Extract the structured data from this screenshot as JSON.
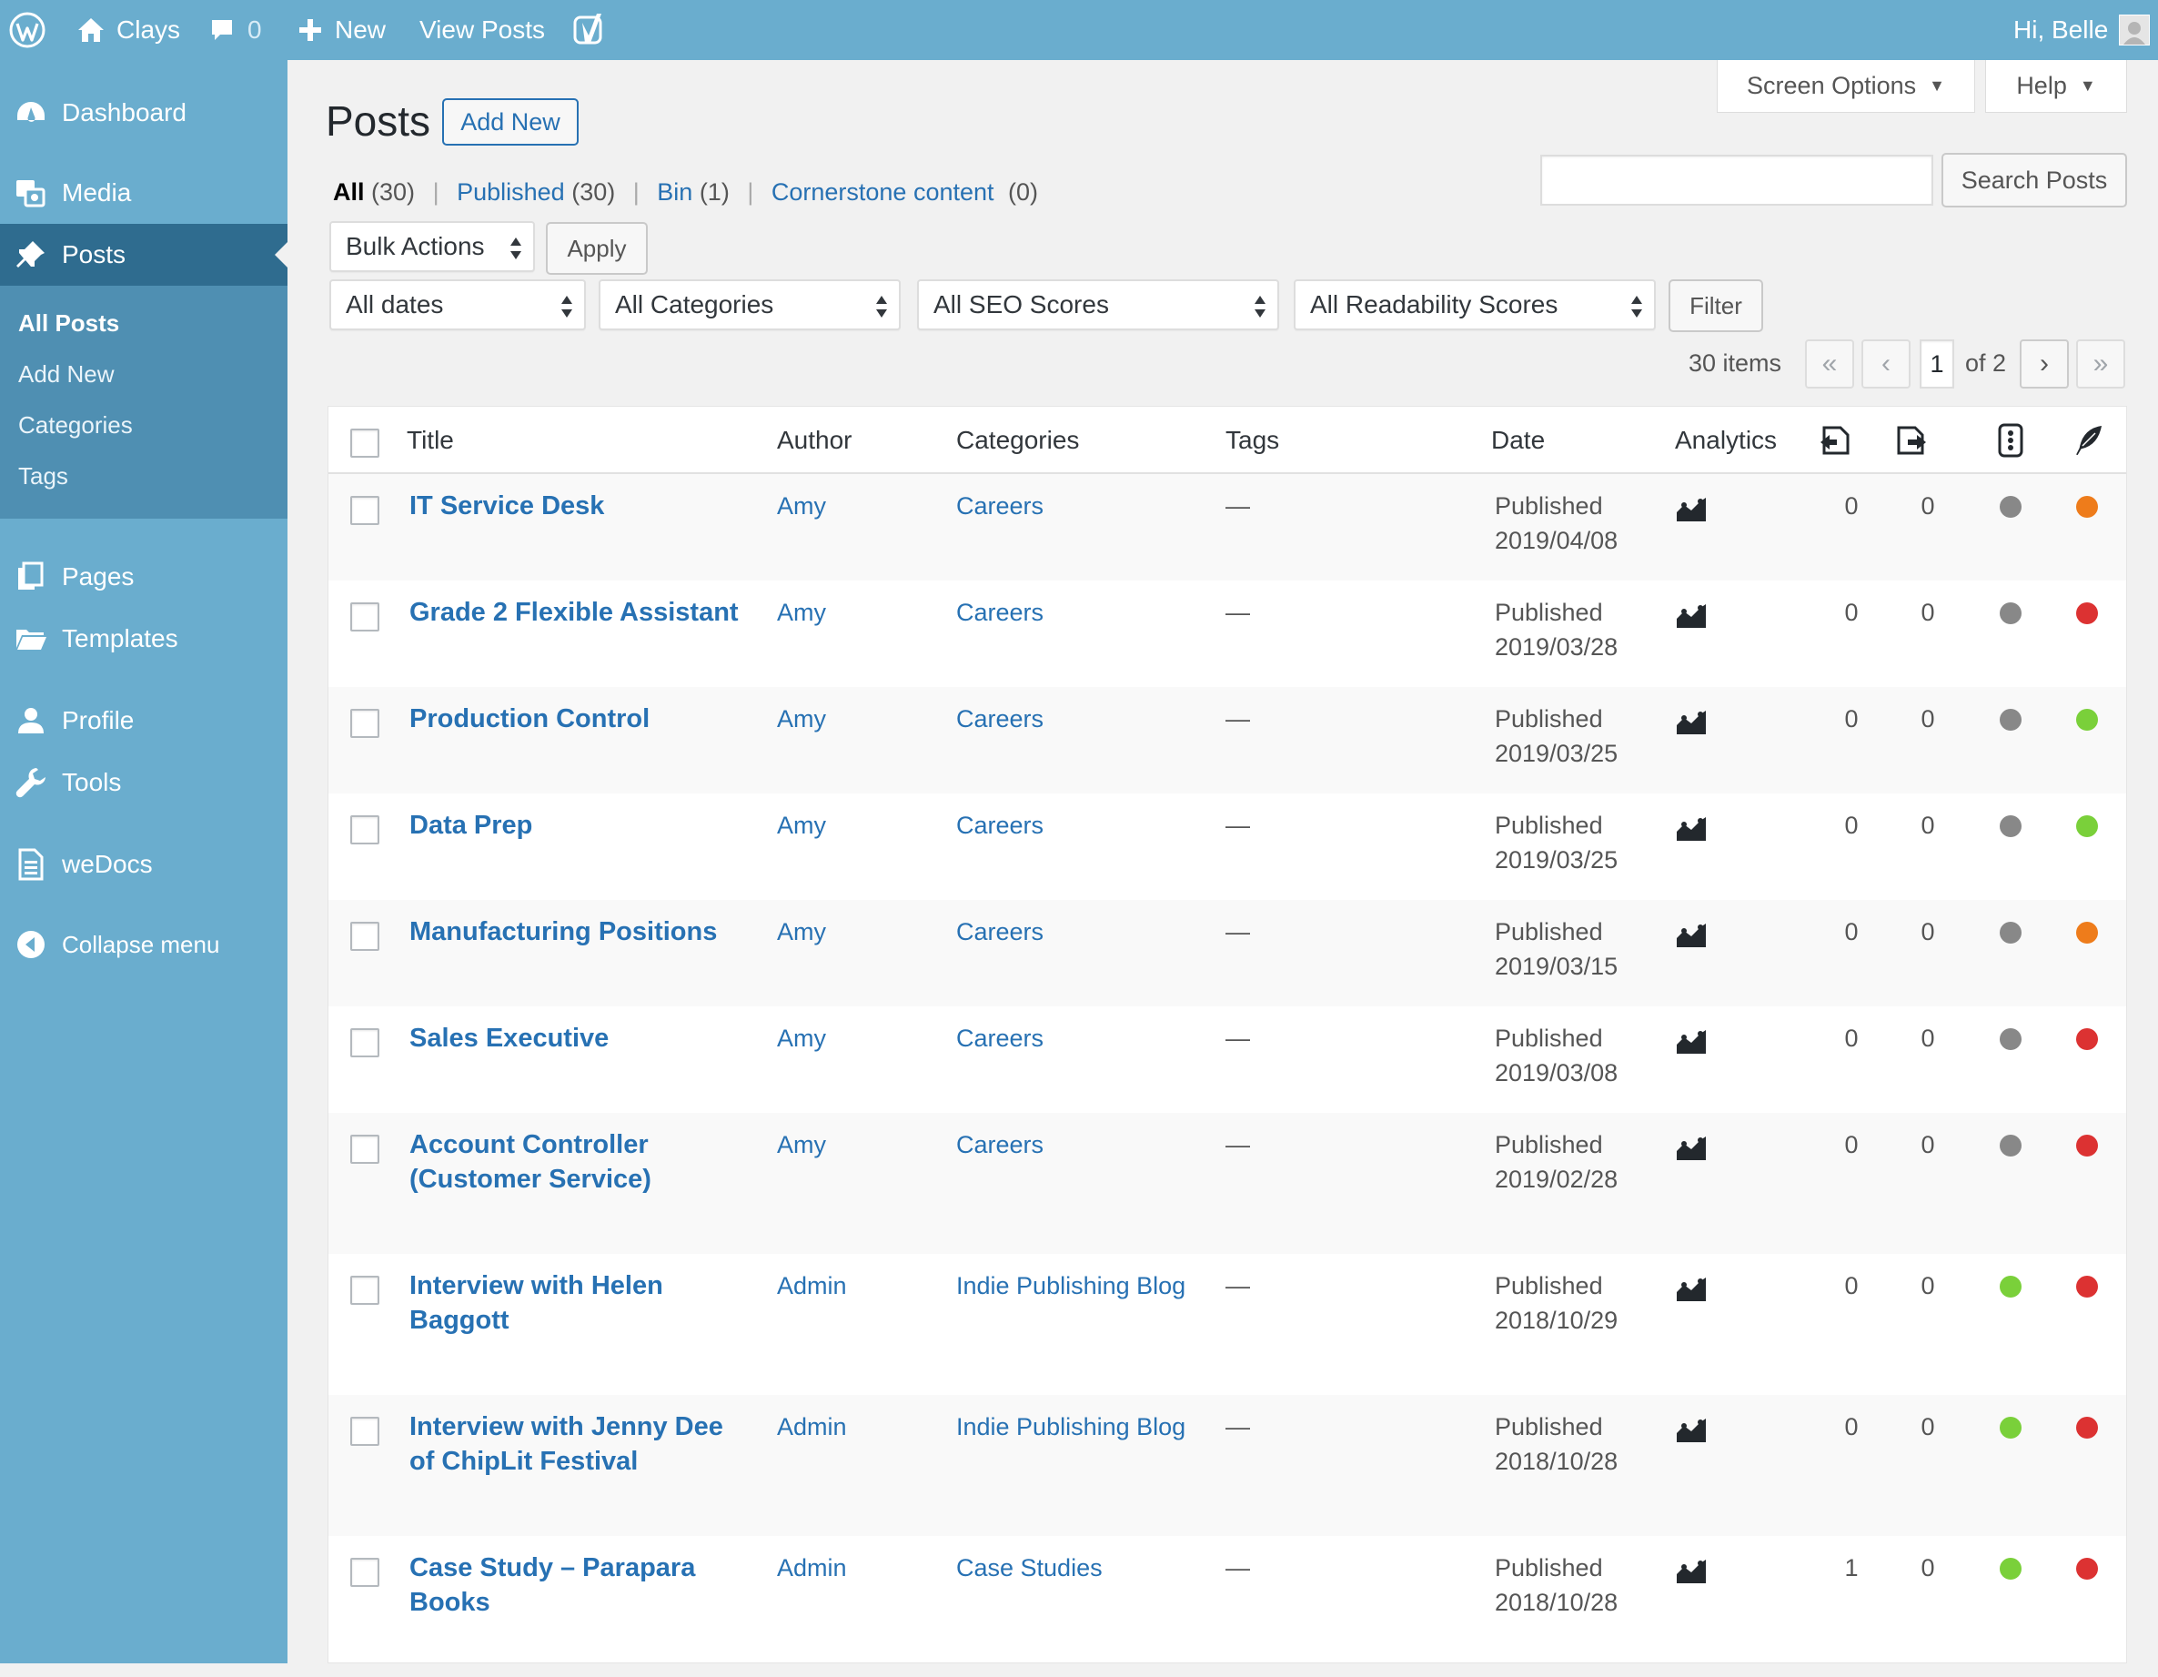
{
  "adminbar": {
    "site_name": "Clays",
    "comments_count": "0",
    "new_label": "New",
    "view_posts_label": "View Posts",
    "greeting": "Hi, Belle"
  },
  "sidebar": {
    "items": [
      {
        "label": "Dashboard",
        "icon": "dashboard-icon"
      },
      {
        "label": "Media",
        "icon": "media-icon"
      },
      {
        "label": "Posts",
        "icon": "pin-icon"
      },
      {
        "label": "Pages",
        "icon": "pages-icon"
      },
      {
        "label": "Templates",
        "icon": "folder-icon"
      },
      {
        "label": "Profile",
        "icon": "user-icon"
      },
      {
        "label": "Tools",
        "icon": "wrench-icon"
      },
      {
        "label": "weDocs",
        "icon": "document-icon"
      },
      {
        "label": "Collapse menu",
        "icon": "collapse-icon"
      }
    ],
    "submenu": [
      "All Posts",
      "Add New",
      "Categories",
      "Tags"
    ]
  },
  "page": {
    "title": "Posts",
    "add_new": "Add New",
    "screen_options": "Screen Options",
    "help": "Help",
    "search_button": "Search Posts",
    "search_value": "",
    "views": {
      "all": "All",
      "all_count": "(30)",
      "published": "Published",
      "published_count": "(30)",
      "bin": "Bin",
      "bin_count": "(1)",
      "cornerstone": "Cornerstone content",
      "cornerstone_count": "(0)",
      "sep": "|"
    },
    "bulk_actions": "Bulk Actions",
    "apply": "Apply",
    "filters": {
      "dates": "All dates",
      "categories": "All Categories",
      "seo": "All SEO Scores",
      "readability": "All Readability Scores",
      "button": "Filter"
    },
    "pagination": {
      "items": "30 items",
      "first": "«",
      "prev": "‹",
      "current": "1",
      "of": "of 2",
      "next": "›",
      "last": "»"
    }
  },
  "table": {
    "columns": {
      "title": "Title",
      "author": "Author",
      "categories": "Categories",
      "tags": "Tags",
      "date": "Date",
      "analytics": "Analytics"
    },
    "status_colors": {
      "grey": "#888888",
      "orange": "#ee7c1b",
      "red": "#dc3232",
      "green": "#7ad03a"
    },
    "rows": [
      {
        "title": "IT Service Desk",
        "author": "Amy",
        "category": "Careers",
        "tags": "—",
        "status": "Published",
        "date": "2019/04/08",
        "links_in": "0",
        "links_out": "0",
        "seo": "grey",
        "readability": "orange"
      },
      {
        "title": "Grade 2 Flexible Assistant",
        "author": "Amy",
        "category": "Careers",
        "tags": "—",
        "status": "Published",
        "date": "2019/03/28",
        "links_in": "0",
        "links_out": "0",
        "seo": "grey",
        "readability": "red"
      },
      {
        "title": "Production Control",
        "author": "Amy",
        "category": "Careers",
        "tags": "—",
        "status": "Published",
        "date": "2019/03/25",
        "links_in": "0",
        "links_out": "0",
        "seo": "grey",
        "readability": "green"
      },
      {
        "title": "Data Prep",
        "author": "Amy",
        "category": "Careers",
        "tags": "—",
        "status": "Published",
        "date": "2019/03/25",
        "links_in": "0",
        "links_out": "0",
        "seo": "grey",
        "readability": "green"
      },
      {
        "title": "Manufacturing Positions",
        "author": "Amy",
        "category": "Careers",
        "tags": "—",
        "status": "Published",
        "date": "2019/03/15",
        "links_in": "0",
        "links_out": "0",
        "seo": "grey",
        "readability": "orange"
      },
      {
        "title": "Sales Executive",
        "author": "Amy",
        "category": "Careers",
        "tags": "—",
        "status": "Published",
        "date": "2019/03/08",
        "links_in": "0",
        "links_out": "0",
        "seo": "grey",
        "readability": "red"
      },
      {
        "title": "Account Controller (Customer Service)",
        "author": "Amy",
        "category": "Careers",
        "tags": "—",
        "status": "Published",
        "date": "2019/02/28",
        "links_in": "0",
        "links_out": "0",
        "seo": "grey",
        "readability": "red"
      },
      {
        "title": "Interview with Helen Baggott",
        "author": "Admin",
        "category": "Indie Publishing Blog",
        "tags": "—",
        "status": "Published",
        "date": "2018/10/29",
        "links_in": "0",
        "links_out": "0",
        "seo": "green",
        "readability": "red"
      },
      {
        "title": "Interview with Jenny Dee of ChipLit Festival",
        "author": "Admin",
        "category": "Indie Publishing Blog",
        "tags": "—",
        "status": "Published",
        "date": "2018/10/28",
        "links_in": "0",
        "links_out": "0",
        "seo": "green",
        "readability": "red"
      },
      {
        "title": "Case Study – Parapara Books",
        "author": "Admin",
        "category": "Case Studies",
        "tags": "—",
        "status": "Published",
        "date": "2018/10/28",
        "links_in": "1",
        "links_out": "0",
        "seo": "green",
        "readability": "red"
      }
    ]
  }
}
